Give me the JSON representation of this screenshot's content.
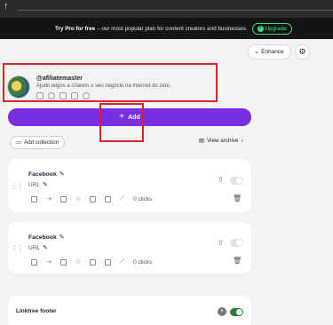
{
  "promo": {
    "strong": "Try Pro for free",
    "rest": " – our most popular plan for content creators and businesses.",
    "upgrade_label": "Upgrade"
  },
  "toolbar": {
    "enhance_label": "Enhance"
  },
  "profile": {
    "handle": "@afiliatemaster",
    "bio": "Ajudo leigos a criarem o seu negócio na internet do zero."
  },
  "actions": {
    "add_label": "Add",
    "add_collection_label": "Add collection",
    "view_archive_label": "View archive"
  },
  "links": [
    {
      "title": "Facebook",
      "url": "URL",
      "clicks": "0 clicks",
      "enabled": false
    },
    {
      "title": "Facebook",
      "url": "URL",
      "clicks": "0 clicks",
      "enabled": false
    }
  ],
  "footer": {
    "label": "Linktree footer",
    "enabled": true
  },
  "colors": {
    "accent": "#7a2ee0",
    "highlight": "#e0202c",
    "upgrade": "#3ddc84",
    "toggle_on": "#2e7d32"
  }
}
